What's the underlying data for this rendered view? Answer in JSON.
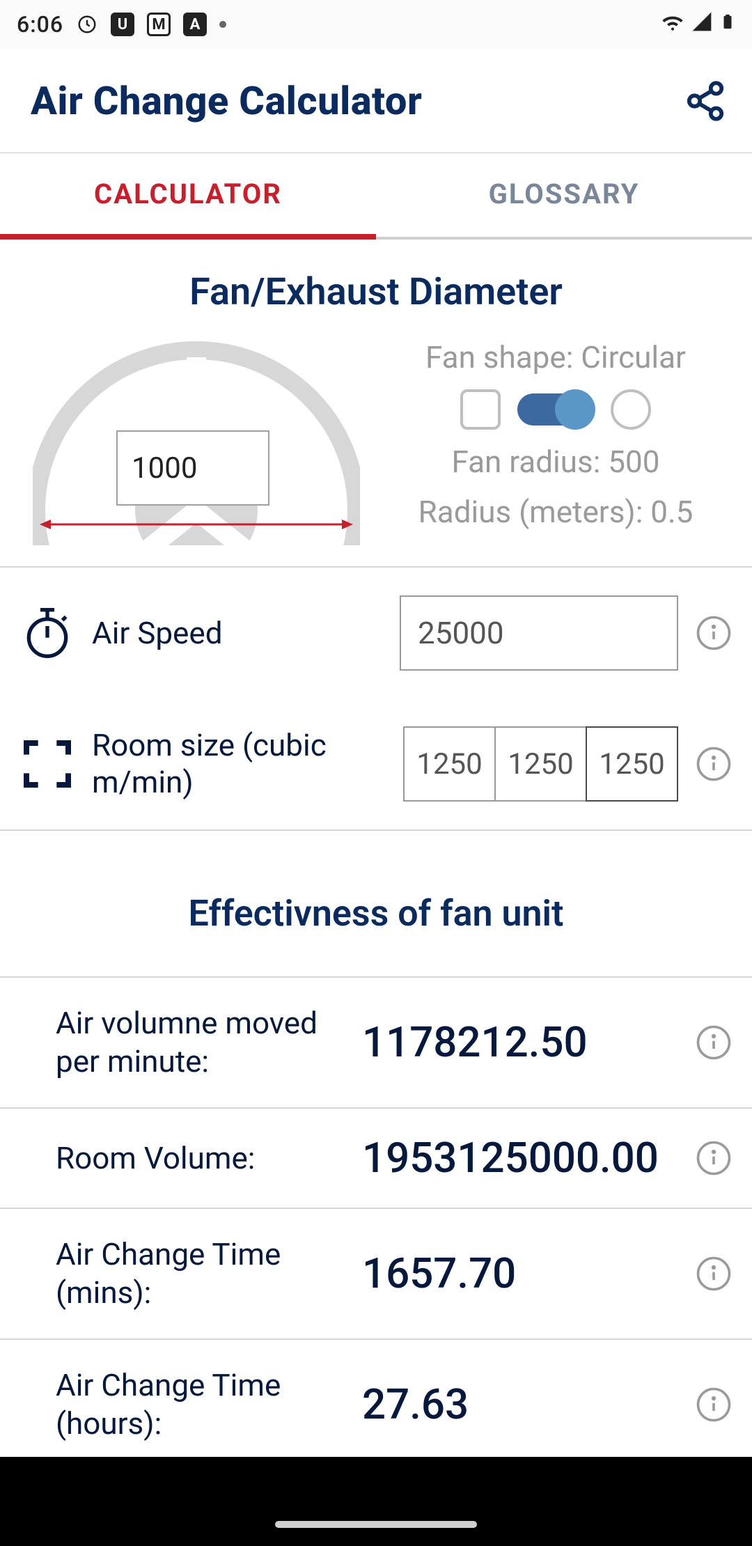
{
  "status": {
    "time": "6:06",
    "left_icons": [
      "clock",
      "box-u",
      "box-m",
      "box-a",
      "dot"
    ],
    "right_icons": [
      "wifi",
      "cell",
      "battery"
    ]
  },
  "appbar": {
    "title": "Air Change Calculator"
  },
  "tabs": {
    "active": 0,
    "items": [
      "CALCULATOR",
      "GLOSSARY"
    ]
  },
  "fan_section": {
    "title": "Fan/Exhaust Diameter",
    "diameter_value": "1000",
    "shape_label": "Fan shape: Circular",
    "fan_radius_label": "Fan radius: 500",
    "radius_meters_label": "Radius (meters): 0.5"
  },
  "inputs": {
    "air_speed": {
      "label": "Air Speed",
      "value": "25000"
    },
    "room_size": {
      "label": "Room size (cubic m/min)",
      "values": [
        "1250",
        "1250",
        "1250"
      ]
    }
  },
  "effectiveness": {
    "title": "Effectivness of fan unit",
    "rows": [
      {
        "label": "Air volumne moved per minute:",
        "value": "1178212.50"
      },
      {
        "label": "Room Volume:",
        "value": "1953125000.00"
      },
      {
        "label": "Air Change Time (mins):",
        "value": "1657.70"
      },
      {
        "label": "Air Change Time (hours):",
        "value": "27.63"
      }
    ]
  }
}
